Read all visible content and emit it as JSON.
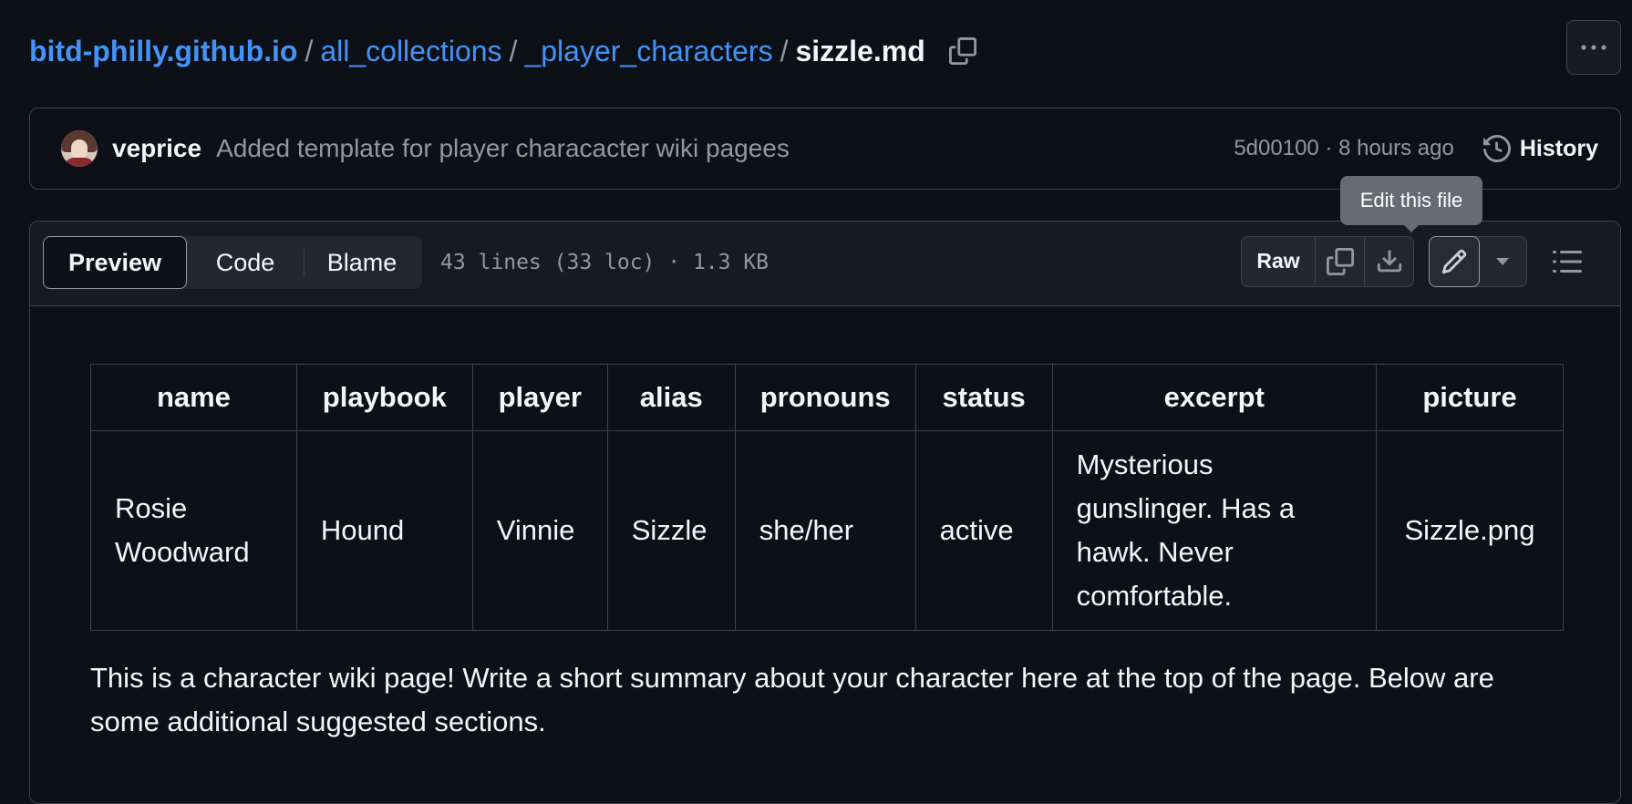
{
  "breadcrumb": {
    "repo": "bitd-philly.github.io",
    "folder1": "all_collections",
    "folder2": "_player_characters",
    "separator": "/",
    "file": "sizzle.md"
  },
  "commit": {
    "author": "veprice",
    "message": "Added template for player characacter wiki pagees",
    "sha_time": "5d00100 · 8 hours ago",
    "history_label": "History"
  },
  "file_header": {
    "tabs": [
      "Preview",
      "Code",
      "Blame"
    ],
    "meta": "43 lines (33 loc) · 1.3 KB",
    "raw_label": "Raw",
    "tooltip": "Edit this file"
  },
  "table": {
    "headers": [
      "name",
      "playbook",
      "player",
      "alias",
      "pronouns",
      "status",
      "excerpt",
      "picture"
    ],
    "row": [
      "Rosie Woodward",
      "Hound",
      "Vinnie",
      "Sizzle",
      "she/her",
      "active",
      "Mysterious gunslinger. Has a hawk. Never comfortable.",
      "Sizzle.png"
    ]
  },
  "summary": "This is a character wiki page! Write a short summary about your character here at the top of the page. Below are some additional suggested sections.",
  "colors": {
    "background": "#0d1117",
    "link": "#4493f8",
    "border": "#3d444d",
    "muted": "#9198a1"
  }
}
